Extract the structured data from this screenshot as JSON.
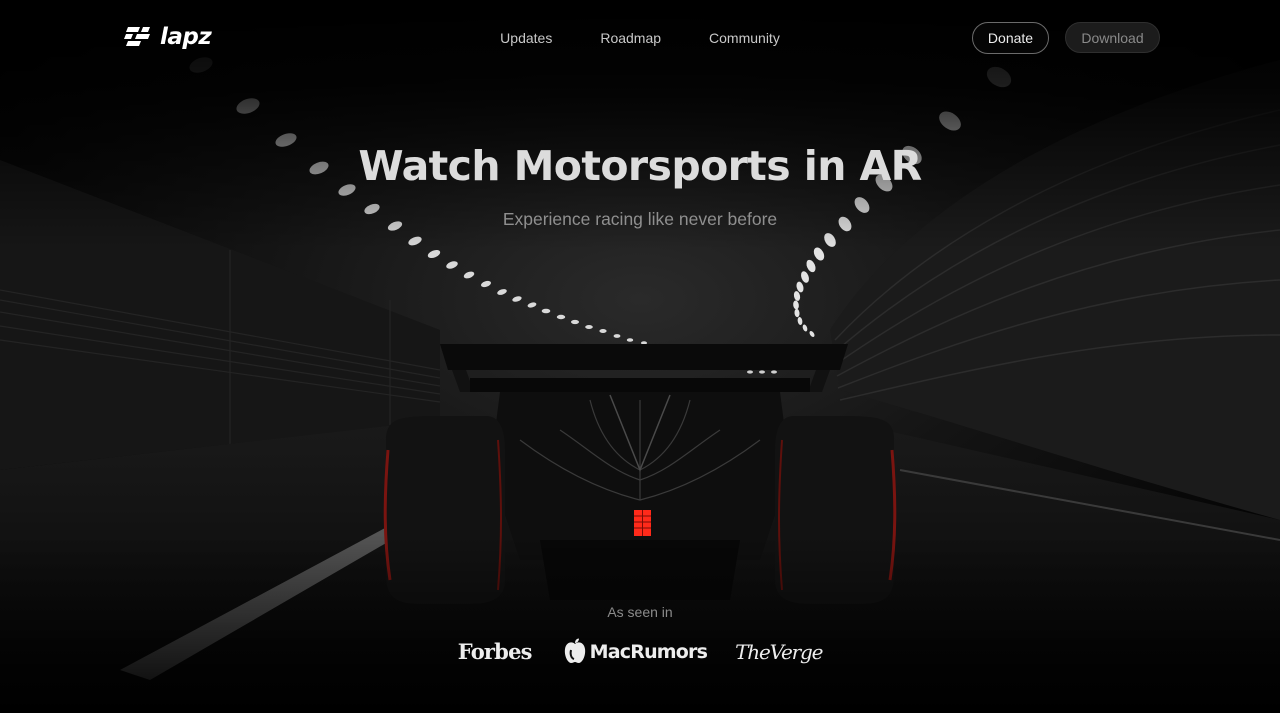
{
  "brand": {
    "name": "lapz",
    "logo_icon": "checkered-flag-icon"
  },
  "nav": {
    "items": [
      "Updates",
      "Roadmap",
      "Community"
    ]
  },
  "actions": {
    "donate": "Donate",
    "download": "Download"
  },
  "hero": {
    "title": "Watch Motorsports in AR",
    "subtitle": "Experience racing like never before"
  },
  "press": {
    "label": "As seen in",
    "outlets": [
      "Forbes",
      "MacRumors",
      "TheVerge"
    ]
  },
  "colors": {
    "background": "#000000",
    "accent_light": "#ff2a1a",
    "text": "#dcdcdc"
  }
}
